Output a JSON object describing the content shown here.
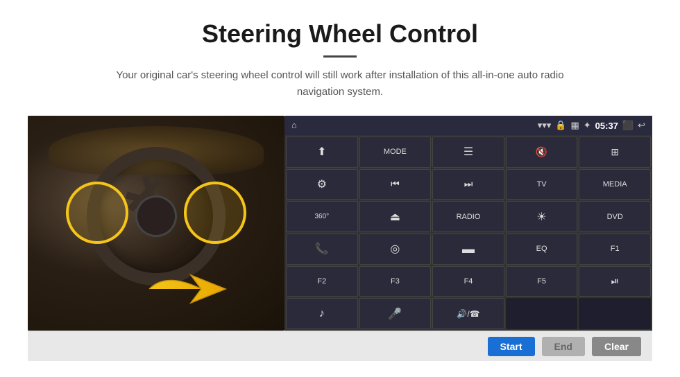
{
  "header": {
    "title": "Steering Wheel Control",
    "subtitle": "Your original car's steering wheel control will still work after installation of this all-in-one auto radio navigation system.",
    "divider": true
  },
  "status_bar": {
    "home_icon": "⌂",
    "wifi_icon": "📶",
    "lock_icon": "🔒",
    "sd_icon": "💾",
    "bt_icon": "🔷",
    "time": "05:37",
    "screen_icon": "⬛",
    "back_icon": "↩"
  },
  "grid_buttons": [
    {
      "id": "r1c1",
      "label": "⬆",
      "type": "icon"
    },
    {
      "id": "r1c2",
      "label": "MODE",
      "type": "text"
    },
    {
      "id": "r1c3",
      "label": "☰",
      "type": "icon"
    },
    {
      "id": "r1c4",
      "label": "🔇",
      "type": "icon"
    },
    {
      "id": "r1c5",
      "label": "⊞",
      "type": "icon"
    },
    {
      "id": "r2c1",
      "label": "⚙",
      "type": "icon"
    },
    {
      "id": "r2c2",
      "label": "⏮",
      "type": "icon"
    },
    {
      "id": "r2c3",
      "label": "⏭",
      "type": "icon"
    },
    {
      "id": "r2c4",
      "label": "TV",
      "type": "text"
    },
    {
      "id": "r2c5",
      "label": "MEDIA",
      "type": "text"
    },
    {
      "id": "r3c1",
      "label": "360°",
      "type": "text"
    },
    {
      "id": "r3c2",
      "label": "⏏",
      "type": "icon"
    },
    {
      "id": "r3c3",
      "label": "RADIO",
      "type": "text"
    },
    {
      "id": "r3c4",
      "label": "☀",
      "type": "icon"
    },
    {
      "id": "r3c5",
      "label": "DVD",
      "type": "text"
    },
    {
      "id": "r4c1",
      "label": "📞",
      "type": "icon"
    },
    {
      "id": "r4c2",
      "label": "☢",
      "type": "icon"
    },
    {
      "id": "r4c3",
      "label": "▬",
      "type": "icon"
    },
    {
      "id": "r4c4",
      "label": "EQ",
      "type": "text"
    },
    {
      "id": "r4c5",
      "label": "F1",
      "type": "text"
    },
    {
      "id": "r5c1",
      "label": "F2",
      "type": "text"
    },
    {
      "id": "r5c2",
      "label": "F3",
      "type": "text"
    },
    {
      "id": "r5c3",
      "label": "F4",
      "type": "text"
    },
    {
      "id": "r5c4",
      "label": "F5",
      "type": "text"
    },
    {
      "id": "r5c5",
      "label": "⏯",
      "type": "icon"
    },
    {
      "id": "r6c1",
      "label": "♪",
      "type": "icon"
    },
    {
      "id": "r6c2",
      "label": "🎤",
      "type": "icon"
    },
    {
      "id": "r6c3",
      "label": "🔊/☎",
      "type": "icon"
    },
    {
      "id": "r6c4",
      "label": "",
      "type": "empty"
    },
    {
      "id": "r6c5",
      "label": "",
      "type": "empty"
    }
  ],
  "bottom_bar": {
    "start_label": "Start",
    "end_label": "End",
    "clear_label": "Clear"
  }
}
